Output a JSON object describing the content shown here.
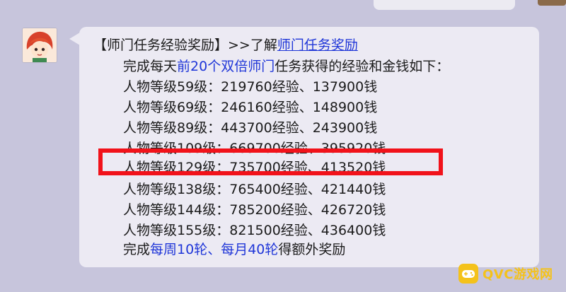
{
  "chat": {
    "title_bracket": "【师门任务经验奖励】",
    "title_prefix": ">>了解",
    "title_link": "师门任务奖励",
    "intro_a": "完成每天",
    "intro_b": "前20个双倍师门",
    "intro_c": "任务获得的经验和金钱如下：",
    "rows": [
      "人物等级59级：219760经验、137900钱",
      "人物等级69级：246160经验、148900钱",
      "人物等级89级：443700经验、243900钱",
      "人物等级109级：669700经验、395920钱",
      "人物等级129级：735700经验、413520钱",
      "人物等级138级：765400经验、421440钱",
      "人物等级144级：785200经验、426720钱",
      "人物等级155级：821500经验、436400钱"
    ],
    "footer_a": "完成",
    "footer_b": "每周10轮、每月40轮",
    "footer_c": "得额外奖励"
  },
  "watermark": {
    "text": "QVC游戏网"
  },
  "colors": {
    "highlight": "#f1121a",
    "link": "#1f36d8",
    "bubble": "#eceaf3",
    "background": "#c7c5dc"
  }
}
